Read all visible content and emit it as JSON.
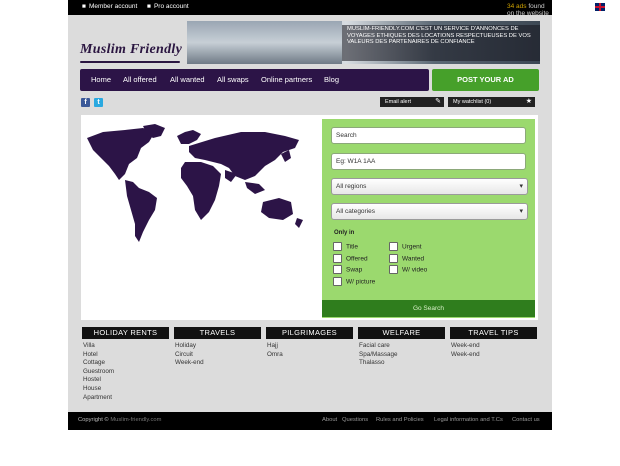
{
  "topbar": {
    "member_account": "Member account",
    "pro_account": "Pro account",
    "online_count": "34 ads",
    "online_suffix": "found on the website !",
    "flag_icon": "uk-flag-icon"
  },
  "logo": {
    "text": "Muslim Friendly"
  },
  "banner": {
    "text": "MUSLIM-FRIENDLY.COM C'EST UN SERVICE D'ANNONCES DE VOYAGES ETHIQUES DES LOCATIONS RESPECTUEUSES DE VOS VALEURS DES PARTENAIRES DE CONFIANCE"
  },
  "nav": {
    "items": [
      {
        "label": "Home"
      },
      {
        "label": "All offered"
      },
      {
        "label": "All wanted"
      },
      {
        "label": "All swaps"
      },
      {
        "label": "Online partners"
      },
      {
        "label": "Blog"
      }
    ],
    "post_ad": "POST YOUR AD"
  },
  "social": {
    "facebook": "f",
    "twitter": "t"
  },
  "tools": {
    "email_alert": "Email alert",
    "watchlist": "My watchlist (0)"
  },
  "search": {
    "keyword_placeholder": "Search",
    "location_placeholder": "Eg: W1A 1AA",
    "regions_selected": "All regions",
    "categories_selected": "All categories",
    "only_in": "Only in",
    "checkboxes": [
      {
        "label": "Title"
      },
      {
        "label": "Urgent"
      },
      {
        "label": "Offered"
      },
      {
        "label": "Wanted"
      },
      {
        "label": "Swap"
      },
      {
        "label": "W/ video"
      },
      {
        "label": "W/ picture"
      }
    ],
    "button": "Go Search"
  },
  "categories": [
    {
      "title": "HOLIDAY RENTS",
      "items": [
        "Villa",
        "Hotel",
        "Cottage",
        "Guestroom",
        "Hostel",
        "House",
        "Apartment"
      ]
    },
    {
      "title": "TRAVELS",
      "items": [
        "Holiday",
        "Circuit",
        "Week-end"
      ]
    },
    {
      "title": "PILGRIMAGES",
      "items": [
        "Hajj",
        "Omra"
      ]
    },
    {
      "title": "WELFARE",
      "items": [
        "Facial care",
        "Spa/Massage",
        "Thalasso"
      ]
    },
    {
      "title": "TRAVEL TIPS",
      "items": [
        "Week-end",
        "Week-end"
      ]
    }
  ],
  "footer": {
    "copyright": "Copyright ©",
    "site": "Muslim-friendly.com",
    "links": [
      {
        "label": "About"
      },
      {
        "label": "Questions"
      },
      {
        "label": "Rules and Policies"
      },
      {
        "label": "Legal information and T.Cs"
      },
      {
        "label": "Contact us"
      }
    ]
  },
  "colors": {
    "nav_bg": "#2c1447",
    "post_ad_bg": "#46a02a",
    "search_panel_bg": "#9bd96e",
    "search_button_bg": "#2f7d1d",
    "map_land": "#2c1447"
  }
}
